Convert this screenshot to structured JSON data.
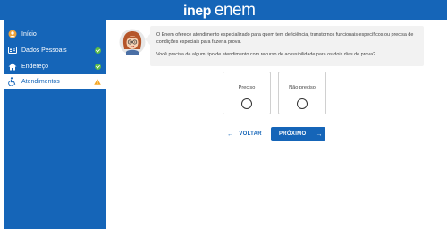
{
  "header": {
    "logo_inep": "inep",
    "logo_enem": "enem"
  },
  "sidebar": {
    "items": [
      {
        "label": "Início",
        "icon": "user-circle-icon",
        "status": "none"
      },
      {
        "label": "Dados Pessoais",
        "icon": "id-card-icon",
        "status": "complete"
      },
      {
        "label": "Endereço",
        "icon": "home-icon",
        "status": "complete"
      },
      {
        "label": "Atendimentos",
        "icon": "accessibility-icon",
        "status": "warning",
        "active": true
      }
    ]
  },
  "message": {
    "line1": "O Enem oferece atendimento especializado para quem tem deficiência, transtornos funcionais específicos ou precisa de",
    "line2": "condições especiais para fazer a prova.",
    "question": "Você precisa de algum tipo de atendimento com recurso de acessibilidade para os dois dias de prova?"
  },
  "options": [
    {
      "label": "Preciso",
      "selected": false
    },
    {
      "label": "Não preciso",
      "selected": false
    }
  ],
  "actions": {
    "back_label": "VOLTAR",
    "next_label": "PRÓXIMO"
  },
  "colors": {
    "brand_blue": "#1565b8",
    "check_green": "#5dbb46",
    "warning_yellow": "#f5a623"
  }
}
